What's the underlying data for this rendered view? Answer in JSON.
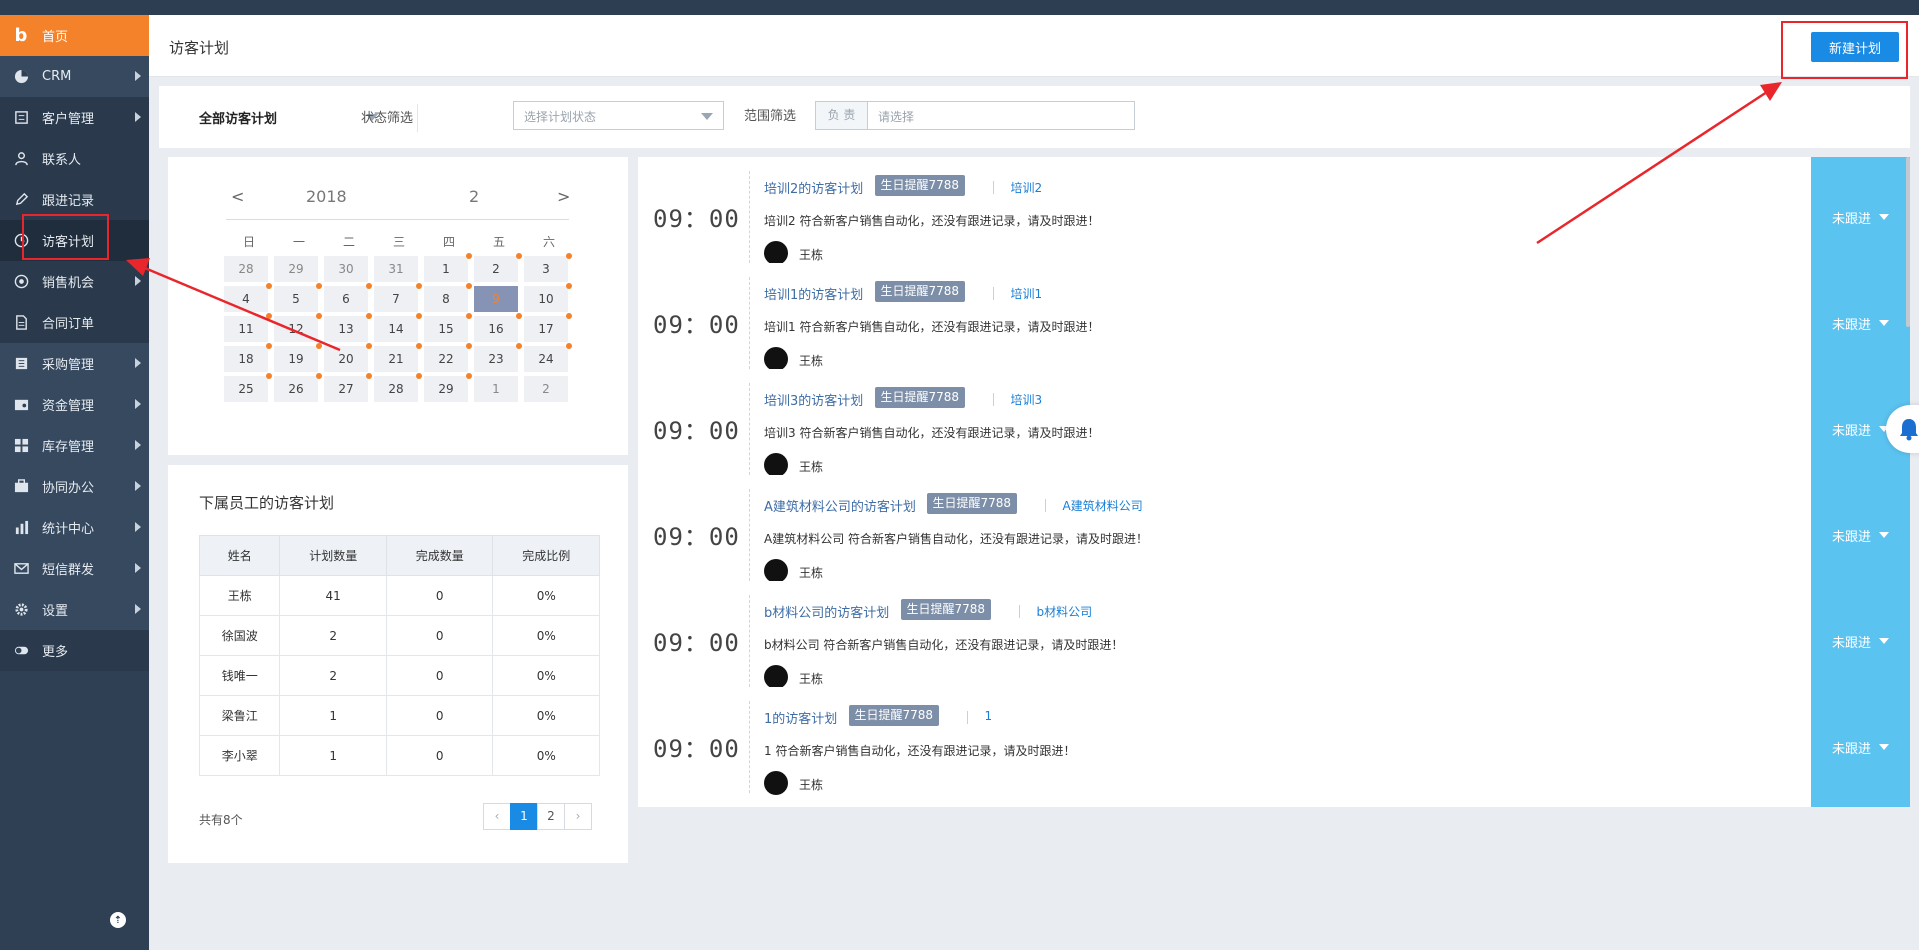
{
  "header": {
    "title": "访客计划",
    "new_button": "新建计划"
  },
  "sidebar": {
    "items": [
      {
        "name": "home",
        "label": "首页",
        "icon": "brand-b-icon",
        "arrow": false
      },
      {
        "name": "crm",
        "label": "CRM",
        "icon": "pie-icon",
        "arrow": true
      },
      {
        "name": "customers",
        "label": "客户管理",
        "icon": "list-icon",
        "arrow": true
      },
      {
        "name": "contacts",
        "label": "联系人",
        "icon": "user-icon",
        "arrow": false
      },
      {
        "name": "followup",
        "label": "跟进记录",
        "icon": "pencil-icon",
        "arrow": false
      },
      {
        "name": "visit-plan",
        "label": "访客计划",
        "icon": "clock-icon",
        "arrow": false
      },
      {
        "name": "opportunity",
        "label": "销售机会",
        "icon": "target-icon",
        "arrow": true
      },
      {
        "name": "contracts",
        "label": "合同订单",
        "icon": "document-icon",
        "arrow": false
      },
      {
        "name": "purchase",
        "label": "采购管理",
        "icon": "book-icon",
        "arrow": true
      },
      {
        "name": "finance",
        "label": "资金管理",
        "icon": "wallet-icon",
        "arrow": true
      },
      {
        "name": "inventory",
        "label": "库存管理",
        "icon": "grid-icon",
        "arrow": true
      },
      {
        "name": "office",
        "label": "协同办公",
        "icon": "briefcase-icon",
        "arrow": true
      },
      {
        "name": "stats",
        "label": "统计中心",
        "icon": "bar-chart-icon",
        "arrow": true
      },
      {
        "name": "sms",
        "label": "短信群发",
        "icon": "envelope-icon",
        "arrow": true
      },
      {
        "name": "settings",
        "label": "设置",
        "icon": "gear-icon",
        "arrow": true
      },
      {
        "name": "more",
        "label": "更多",
        "icon": "toggle-icon",
        "arrow": false
      }
    ]
  },
  "filter": {
    "scope": "全部访客计划",
    "status_label": "状态筛选",
    "status_placeholder": "选择计划状态",
    "range_label": "范围筛选",
    "range_prefix": "负 责",
    "range_placeholder": "请选择"
  },
  "calendar": {
    "prev": "<",
    "next": ">",
    "year": "2018",
    "month": "2",
    "weekdays": [
      "日",
      "一",
      "二",
      "三",
      "四",
      "五",
      "六"
    ],
    "rows": [
      [
        {
          "d": "28",
          "out": true,
          "dot": false
        },
        {
          "d": "29",
          "out": true,
          "dot": false
        },
        {
          "d": "30",
          "out": true,
          "dot": false
        },
        {
          "d": "31",
          "out": true,
          "dot": false
        },
        {
          "d": "1",
          "out": false,
          "dot": true
        },
        {
          "d": "2",
          "out": false,
          "dot": true
        },
        {
          "d": "3",
          "out": false,
          "dot": true
        }
      ],
      [
        {
          "d": "4",
          "out": false,
          "dot": true
        },
        {
          "d": "5",
          "out": false,
          "dot": true
        },
        {
          "d": "6",
          "out": false,
          "dot": true
        },
        {
          "d": "7",
          "out": false,
          "dot": true
        },
        {
          "d": "8",
          "out": false,
          "dot": true
        },
        {
          "d": "9",
          "out": false,
          "dot": false,
          "sel": true
        },
        {
          "d": "10",
          "out": false,
          "dot": true
        }
      ],
      [
        {
          "d": "11",
          "out": false,
          "dot": true
        },
        {
          "d": "12",
          "out": false,
          "dot": true
        },
        {
          "d": "13",
          "out": false,
          "dot": true
        },
        {
          "d": "14",
          "out": false,
          "dot": true
        },
        {
          "d": "15",
          "out": false,
          "dot": true
        },
        {
          "d": "16",
          "out": false,
          "dot": true
        },
        {
          "d": "17",
          "out": false,
          "dot": true
        }
      ],
      [
        {
          "d": "18",
          "out": false,
          "dot": true
        },
        {
          "d": "19",
          "out": false,
          "dot": true
        },
        {
          "d": "20",
          "out": false,
          "dot": true
        },
        {
          "d": "21",
          "out": false,
          "dot": true
        },
        {
          "d": "22",
          "out": false,
          "dot": true
        },
        {
          "d": "23",
          "out": false,
          "dot": true
        },
        {
          "d": "24",
          "out": false,
          "dot": true
        }
      ],
      [
        {
          "d": "25",
          "out": false,
          "dot": true
        },
        {
          "d": "26",
          "out": false,
          "dot": true
        },
        {
          "d": "27",
          "out": false,
          "dot": true
        },
        {
          "d": "28",
          "out": false,
          "dot": true
        },
        {
          "d": "29",
          "out": false,
          "dot": true
        },
        {
          "d": "1",
          "out": true,
          "dot": false
        },
        {
          "d": "2",
          "out": true,
          "dot": false
        }
      ]
    ]
  },
  "subordinates": {
    "title": "下属员工的访客计划",
    "columns": [
      "姓名",
      "计划数量",
      "完成数量",
      "完成比例"
    ],
    "rows": [
      [
        "王栋",
        "41",
        "0",
        "0%"
      ],
      [
        "徐国波",
        "2",
        "0",
        "0%"
      ],
      [
        "钱唯一",
        "2",
        "0",
        "0%"
      ],
      [
        "梁鲁江",
        "1",
        "0",
        "0%"
      ],
      [
        "李小翠",
        "1",
        "0",
        "0%"
      ]
    ],
    "total": "共有8个",
    "pages": [
      "1",
      "2"
    ],
    "current_page": "1"
  },
  "plans": [
    {
      "time": "09：00",
      "title": "培训2的访客计划",
      "badge": "生日提醒7788",
      "link": "培训2",
      "desc": "培训2 符合新客户销售自动化，还没有跟进记录，请及时跟进！",
      "owner": "王栋",
      "status": "未跟进"
    },
    {
      "time": "09：00",
      "title": "培训1的访客计划",
      "badge": "生日提醒7788",
      "link": "培训1",
      "desc": "培训1 符合新客户销售自动化，还没有跟进记录，请及时跟进！",
      "owner": "王栋",
      "status": "未跟进"
    },
    {
      "time": "09：00",
      "title": "培训3的访客计划",
      "badge": "生日提醒7788",
      "link": "培训3",
      "desc": "培训3 符合新客户销售自动化，还没有跟进记录，请及时跟进！",
      "owner": "王栋",
      "status": "未跟进"
    },
    {
      "time": "09：00",
      "title": "A建筑材料公司的访客计划",
      "badge": "生日提醒7788",
      "link": "A建筑材料公司",
      "desc": "A建筑材料公司 符合新客户销售自动化，还没有跟进记录，请及时跟进！",
      "owner": "王栋",
      "status": "未跟进"
    },
    {
      "time": "09：00",
      "title": "b材料公司的访客计划",
      "badge": "生日提醒7788",
      "link": "b材料公司",
      "desc": "b材料公司 符合新客户销售自动化，还没有跟进记录，请及时跟进！",
      "owner": "王栋",
      "status": "未跟进"
    },
    {
      "time": "09：00",
      "title": "1的访客计划",
      "badge": "生日提醒7788",
      "link": "1",
      "desc": "1 符合新客户销售自动化，还没有跟进记录，请及时跟进！",
      "owner": "王栋",
      "status": "未跟进"
    }
  ],
  "colors": {
    "accent": "#1a8be5",
    "home_orange": "#f4822a",
    "sidebar_bg": "#2f4054",
    "status_cyan": "#5bc3f0",
    "badge_gray": "#7d8fa8",
    "annotation_red": "#e8262b"
  }
}
